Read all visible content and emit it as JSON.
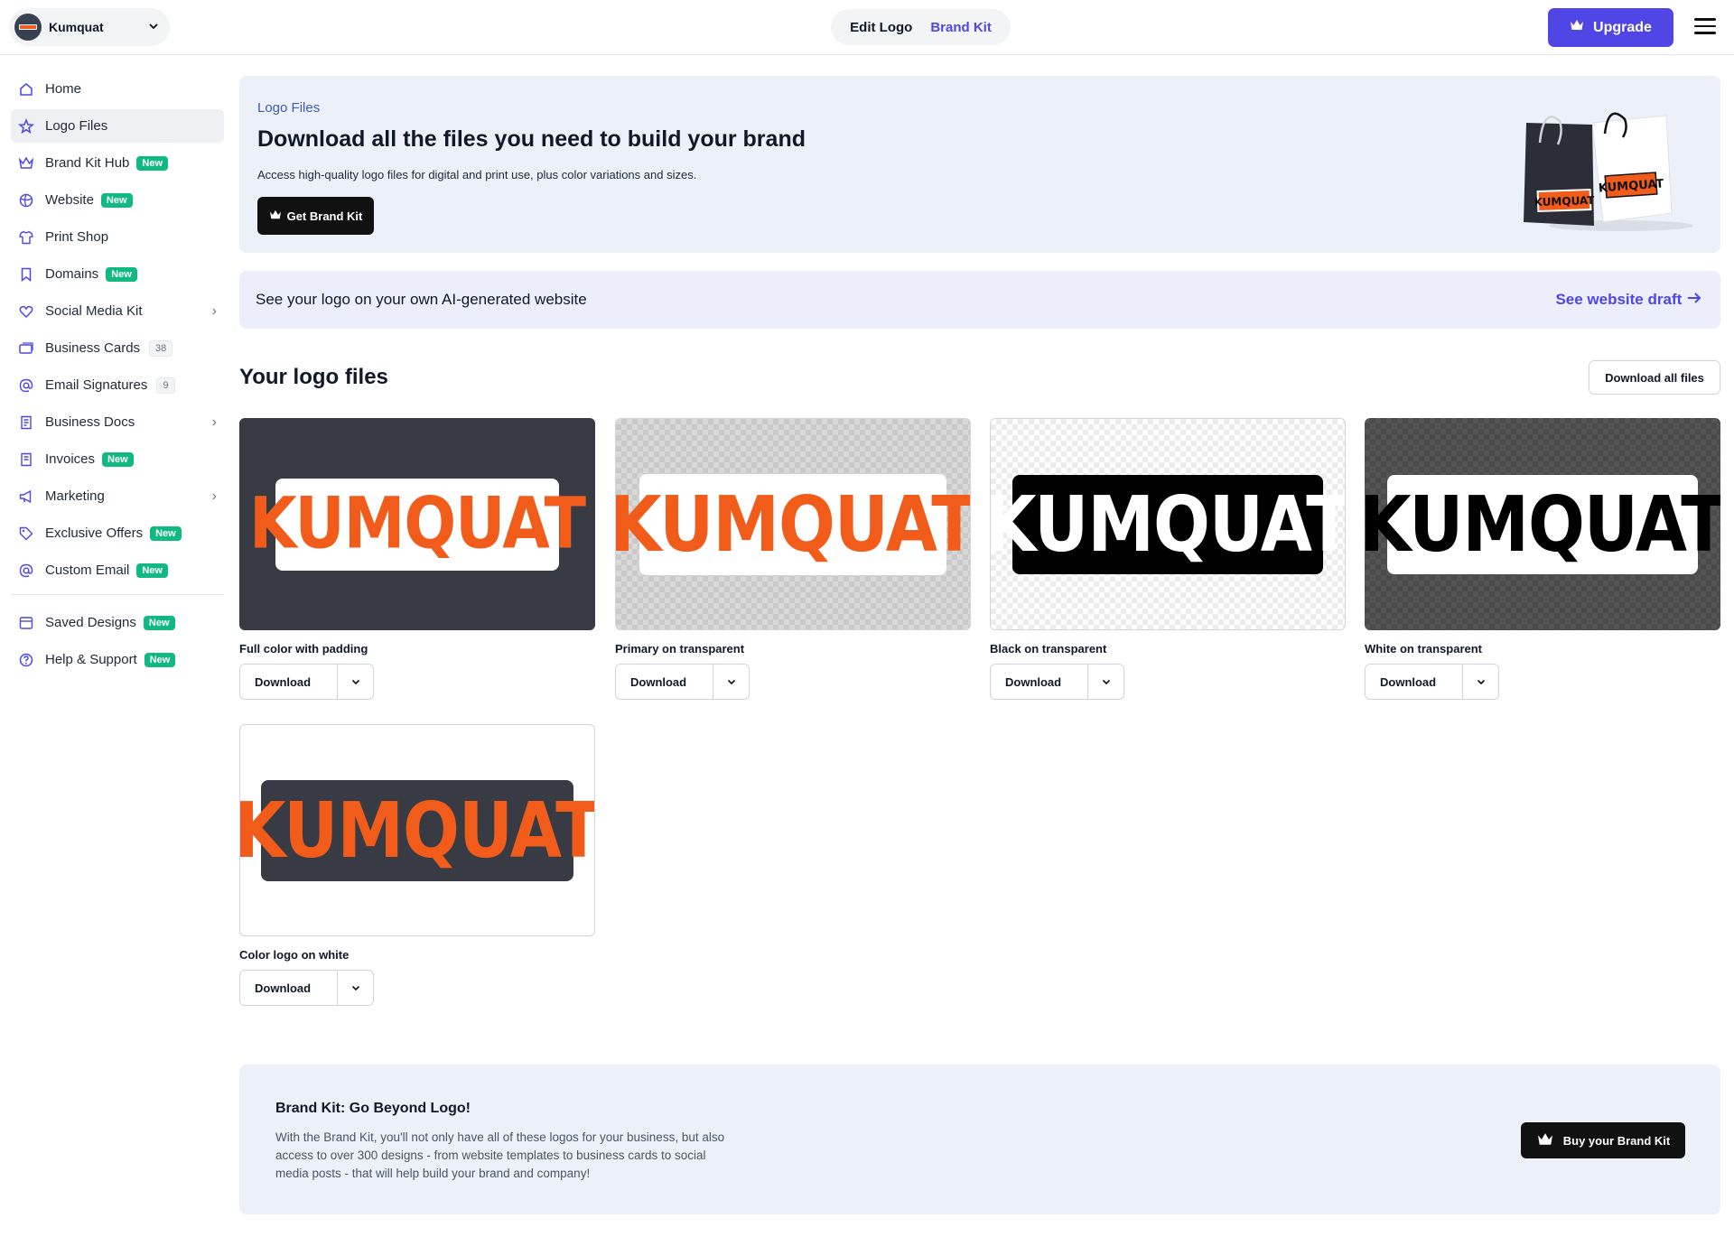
{
  "header": {
    "brand_name": "Kumquat",
    "tabs": [
      "Edit Logo",
      "Brand Kit"
    ],
    "upgrade_label": "Upgrade",
    "accent_color": "#4f46e5"
  },
  "sidebar": {
    "items": [
      {
        "label": "Home",
        "icon": "home-icon"
      },
      {
        "label": "Logo Files",
        "icon": "star-icon",
        "active": true
      },
      {
        "label": "Brand Kit Hub",
        "icon": "crown-icon",
        "badge": "New"
      },
      {
        "label": "Website",
        "icon": "globe-icon",
        "badge": "New"
      },
      {
        "label": "Print Shop",
        "icon": "shirt-icon"
      },
      {
        "label": "Domains",
        "icon": "bookmark-icon",
        "badge": "New"
      },
      {
        "label": "Social Media Kit",
        "icon": "heart-icon"
      },
      {
        "label": "Business Cards",
        "icon": "card-icon",
        "count": "38"
      },
      {
        "label": "Email Signatures",
        "icon": "at-icon",
        "count": "9"
      },
      {
        "label": "Business Docs",
        "icon": "doc-icon"
      },
      {
        "label": "Invoices",
        "icon": "invoice-icon",
        "badge": "New"
      },
      {
        "label": "Marketing",
        "icon": "megaphone-icon"
      },
      {
        "label": "Exclusive Offers",
        "icon": "tag-icon",
        "badge": "New"
      },
      {
        "label": "Custom Email",
        "icon": "at-icon",
        "badge": "New"
      },
      {
        "label": "Saved Designs",
        "icon": "saved-icon",
        "badge": "New"
      },
      {
        "label": "Help & Support",
        "icon": "help-icon",
        "badge": "New"
      }
    ]
  },
  "hero": {
    "kicker": "Logo Files",
    "title": "Download all the files you need to build your brand",
    "description": "Access high-quality logo files for digital and print use, plus color variations and sizes.",
    "button_label": "Get Brand Kit",
    "bag_logo_text": "KUMQUAT"
  },
  "website_banner": {
    "text": "See your logo on your own AI-generated website",
    "link_label": "See website draft"
  },
  "logo_files": {
    "title": "Your logo files",
    "download_all_label": "Download all files",
    "logo_word": "KUMQUAT",
    "brand_orange": "#f25c1b",
    "cards": [
      {
        "label": "Full color with padding",
        "button": "Download"
      },
      {
        "label": "Primary on transparent",
        "button": "Download"
      },
      {
        "label": "Black on transparent",
        "button": "Download"
      },
      {
        "label": "White on transparent",
        "button": "Download"
      },
      {
        "label": "Color logo on white",
        "button": "Download"
      }
    ]
  },
  "promo": {
    "title": "Brand Kit: Go Beyond Logo!",
    "text": "With the Brand Kit, you'll not only have all of these logos for your business, but also access to over 300 designs - from website templates to business cards to social media posts - that will help build your brand and company!",
    "button_label": "Buy your Brand Kit"
  }
}
